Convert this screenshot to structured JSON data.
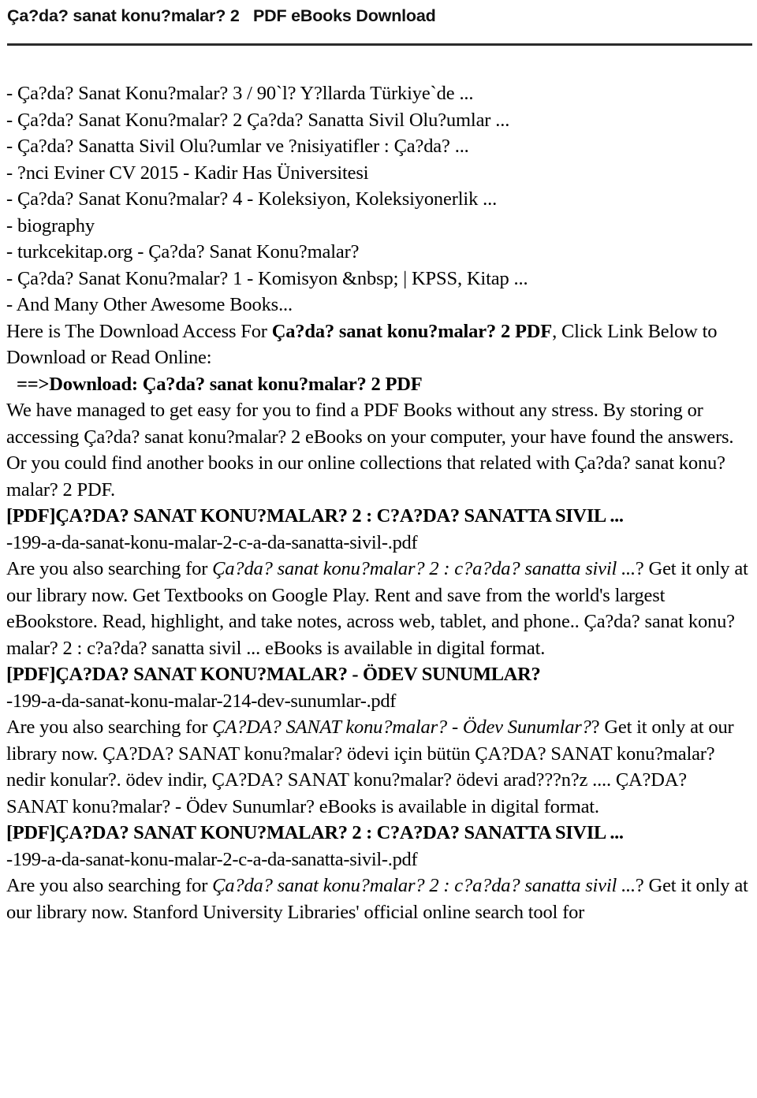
{
  "header": {
    "title": "Ça?da? sanat konu?malar? 2   PDF eBooks Download"
  },
  "book_list": {
    "items": [
      "- Ça?da? Sanat Konu?malar? 3 / 90`l? Y?llarda Türkiye`de ...",
      "- Ça?da? Sanat Konu?malar? 2 Ça?da? Sanatta Sivil Olu?umlar ...",
      "- Ça?da? Sanatta Sivil Olu?umlar ve ?nisiyatifler : Ça?da? ...",
      "- ?nci Eviner CV 2015 - Kadir Has Üniversitesi",
      "- Ça?da? Sanat Konu?malar? 4 - Koleksiyon, Koleksiyonerlik ...",
      "- biography",
      "- turkcekitap.org - Ça?da? Sanat Konu?malar?",
      "- Ça?da? Sanat Konu?malar? 1 - Komisyon &nbsp; | KPSS, Kitap ...",
      "- And Many Other Awesome Books..."
    ]
  },
  "intro": {
    "lead_prefix": "Here is The Download Access For ",
    "lead_bold": "Ça?da? sanat konu?malar? 2 PDF",
    "lead_suffix": ", Click Link Below to Download or Read Online:",
    "download_link": "==>Download: Ça?da? sanat konu?malar? 2 PDF",
    "body_part1": "We have managed to get easy for you to find a PDF Books without any stress. By storing or accessing Ça?da? sanat konu?malar? 2 eBooks on your computer, your have found the answers. Or you could find another books in our online collections that related with Ça?da? sanat konu?malar? 2 PDF."
  },
  "sections": [
    {
      "heading": "[PDF]ÇA?DA? SANAT KONU?MALAR? 2 : C?A?DA? SANATTA SIVIL ...",
      "filename": "-199-a-da-sanat-konu-malar-2-c-a-da-sanatta-sivil-.pdf",
      "desc_prefix": "Are you also searching for ",
      "desc_italic": "Ça?da? sanat konu?malar? 2 : c?a?da? sanatta sivil ...",
      "desc_suffix": "? Get it only at our library now. Get Textbooks on Google Play. Rent and save from the world's largest eBookstore. Read, highlight, and take notes, across web, tablet, and phone.. Ça?da? sanat konu?malar? 2 : c?a?da? sanatta sivil ... eBooks is available in digital format."
    },
    {
      "heading": "[PDF]ÇA?DA? SANAT KONU?MALAR? - ÖDEV SUNUMLAR?",
      "filename": "-199-a-da-sanat-konu-malar-214-dev-sunumlar-.pdf",
      "desc_prefix": "Are you also searching for ",
      "desc_italic": "ÇA?DA? SANAT konu?malar? - Ödev Sunumlar?",
      "desc_suffix": "? Get it only at our library now. ÇA?DA? SANAT konu?malar? ödevi için bütün ÇA?DA? SANAT konu?malar? nedir konular?. ödev indir, ÇA?DA? SANAT konu?malar? ödevi arad???n?z .... ÇA?DA? SANAT konu?malar? - Ödev Sunumlar? eBooks is available in digital format."
    },
    {
      "heading": "[PDF]ÇA?DA? SANAT KONU?MALAR? 2 : C?A?DA? SANATTA SIVIL ...",
      "filename": "-199-a-da-sanat-konu-malar-2-c-a-da-sanatta-sivil-.pdf",
      "desc_prefix": "Are you also searching for ",
      "desc_italic": "Ça?da? sanat konu?malar? 2 : c?a?da? sanatta sivil ...",
      "desc_suffix": "? Get it only at our library now. Stanford University Libraries' official online search tool for"
    }
  ]
}
